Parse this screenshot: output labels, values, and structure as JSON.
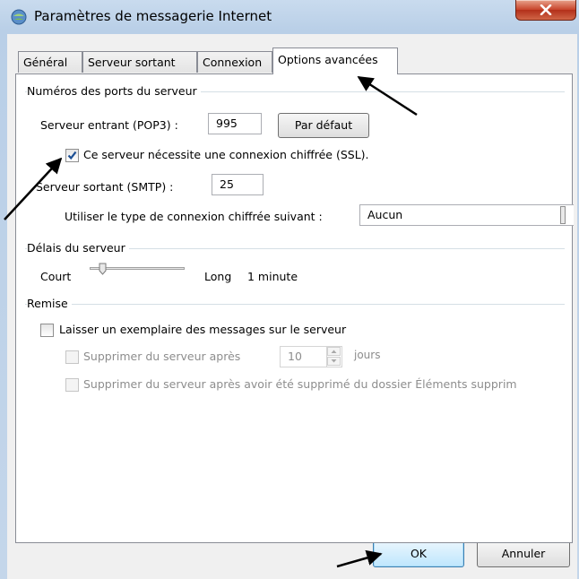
{
  "window": {
    "title": "Paramètres de messagerie Internet",
    "close_icon": "close-icon"
  },
  "tabs": [
    {
      "label": "Général",
      "active": false
    },
    {
      "label": "Serveur sortant",
      "active": false
    },
    {
      "label": "Connexion",
      "active": false
    },
    {
      "label": "Options avancées",
      "active": true
    }
  ],
  "ports": {
    "group_label": "Numéros des ports du serveur",
    "incoming_label": "Serveur entrant (POP3) :",
    "incoming_value": "995",
    "default_button": "Par défaut",
    "ssl_label": "Ce serveur nécessite une connexion chiffrée (SSL).",
    "ssl_checked": true,
    "outgoing_label": "Serveur sortant (SMTP) :",
    "outgoing_value": "25",
    "encryption_label": "Utiliser le type de connexion chiffrée suivant :",
    "encryption_value": "Aucun"
  },
  "timeouts": {
    "group_label": "Délais du serveur",
    "short_label": "Court",
    "long_label": "Long",
    "value_label": "1 minute",
    "slider_fraction": 0.1
  },
  "delivery": {
    "group_label": "Remise",
    "leave_copy_label": "Laisser un exemplaire des messages sur le serveur",
    "leave_copy_checked": false,
    "remove_after_label": "Supprimer du serveur après",
    "remove_after_days": "10",
    "days_unit": "jours",
    "remove_deleted_label": "Supprimer du serveur après avoir été supprimé du dossier Éléments supprim"
  },
  "footer": {
    "ok_label": "OK",
    "cancel_label": "Annuler"
  },
  "colors": {
    "annotation_arrow": "#000000",
    "checkbox_mark": "#1c4f94"
  }
}
